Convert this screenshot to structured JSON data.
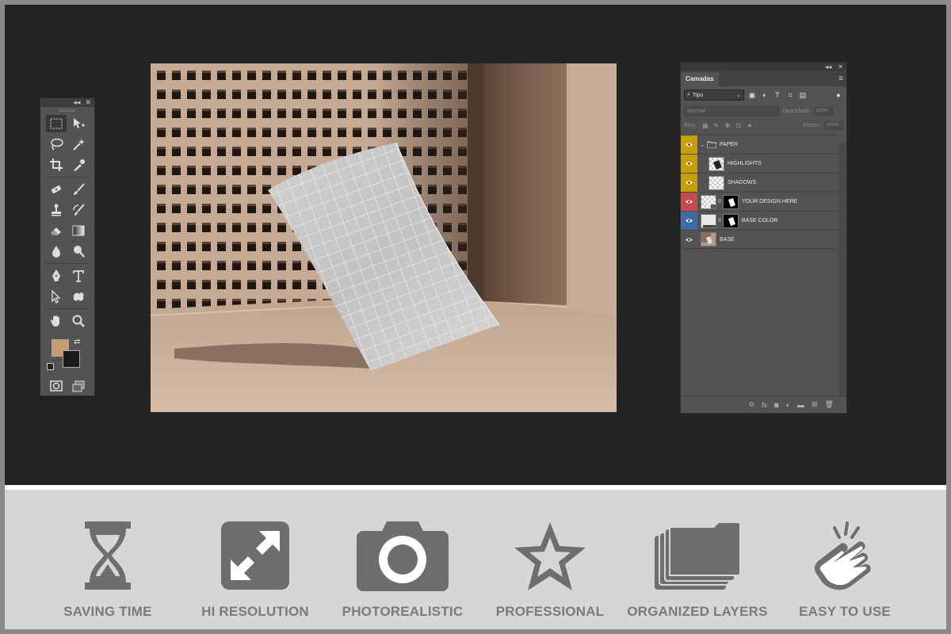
{
  "toolbar": {
    "collapse_label": "◂◂",
    "close_label": "✕",
    "foreground_color": "#c59d6e",
    "background_color": "#1a1a1a",
    "tools": [
      [
        "rectangular-marquee-icon",
        "move-icon"
      ],
      [
        "lasso-icon",
        "magic-wand-icon"
      ],
      [
        "crop-icon",
        "eyedropper-icon"
      ],
      [
        "healing-brush-icon",
        "brush-icon"
      ],
      [
        "clone-stamp-icon",
        "history-brush-icon"
      ],
      [
        "eraser-icon",
        "gradient-icon"
      ],
      [
        "blur-icon",
        "dodge-icon"
      ],
      [
        "pen-icon",
        "type-icon"
      ],
      [
        "path-selection-icon",
        "custom-shape-icon"
      ],
      [
        "hand-icon",
        "zoom-icon"
      ]
    ]
  },
  "layers_panel": {
    "collapse_label": "◂◂",
    "close_label": "✕",
    "tab_label": "Camadas",
    "filter_label": "Tipo",
    "blend_mode": "Normal",
    "opacity_label": "Opacidade:",
    "opacity_value": "100%",
    "lock_label": "Bloq.:",
    "fill_label": "Preen.:",
    "fill_value": "100%",
    "layers": [
      {
        "name": "PAPER",
        "eye_color": "#c5a000",
        "type": "group"
      },
      {
        "name": "HIGHLIGHTS",
        "eye_color": "#c5a000",
        "type": "layer"
      },
      {
        "name": "SHADOWS",
        "eye_color": "#c5a000",
        "type": "layer"
      },
      {
        "name": "YOUR DESIGN HERE",
        "eye_color": "#c94a4a",
        "type": "smart"
      },
      {
        "name": "BASE COLOR",
        "eye_color": "#3e6aa6",
        "type": "fill"
      },
      {
        "name": "BASE",
        "eye_color": "#535353",
        "type": "image"
      }
    ]
  },
  "features": [
    {
      "label": "SAVING TIME",
      "icon": "hourglass-icon"
    },
    {
      "label": "HI RESOLUTION",
      "icon": "expand-arrows-icon"
    },
    {
      "label": "PHOTOREALISTIC",
      "icon": "camera-icon"
    },
    {
      "label": "PROFESSIONAL",
      "icon": "star-icon"
    },
    {
      "label": "ORGANIZED LAYERS",
      "icon": "folders-icon"
    },
    {
      "label": "EASY TO USE",
      "icon": "tap-hand-icon"
    }
  ],
  "colors": {
    "workspace": "#232323",
    "panel": "#535353",
    "feature_icon": "#6e6e6e",
    "feature_text": "#7a7a7a"
  }
}
